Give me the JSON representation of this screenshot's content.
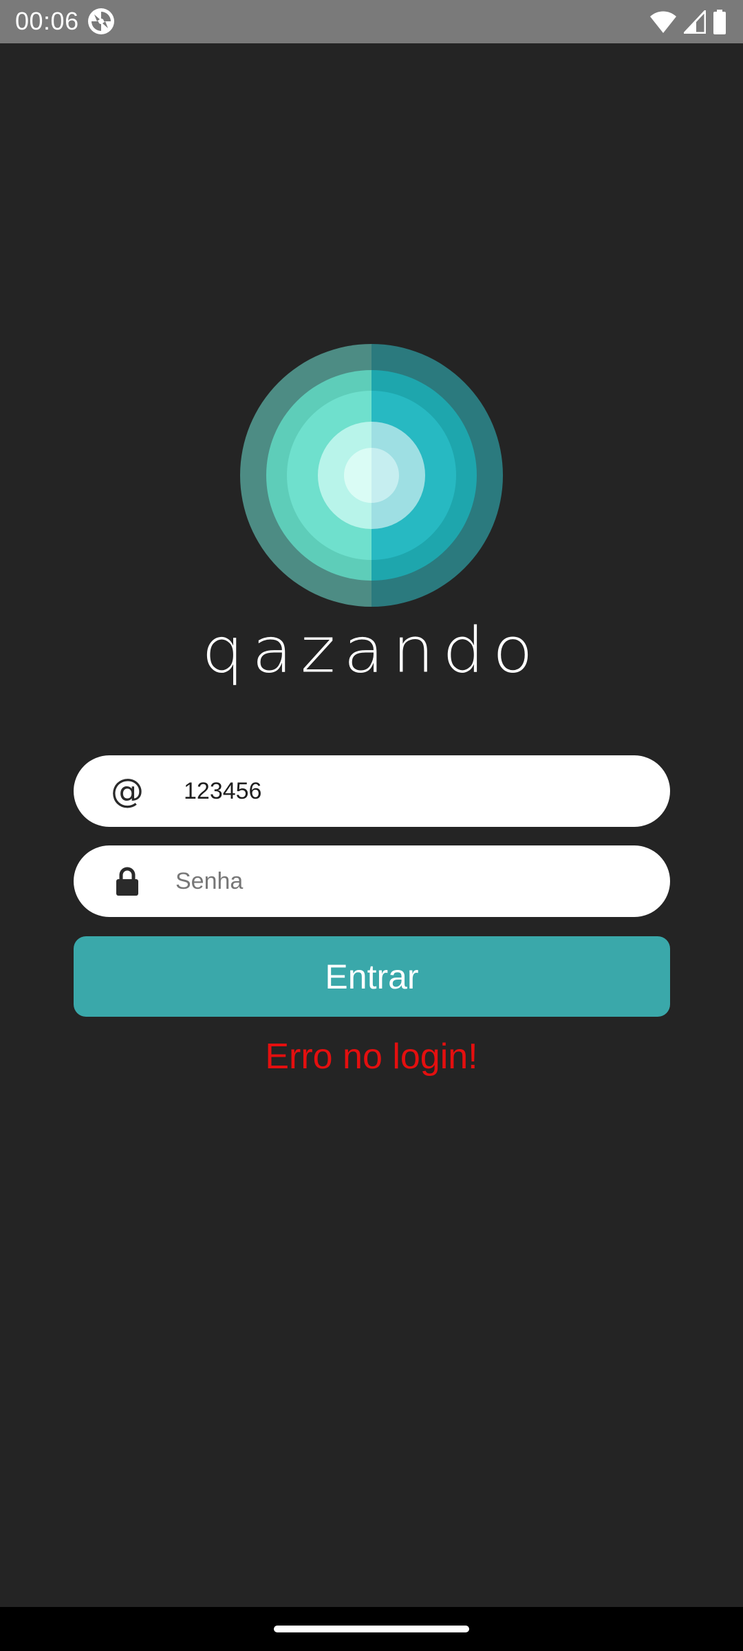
{
  "status_bar": {
    "time": "00:06",
    "icons": [
      "app-notification-icon",
      "wifi-icon",
      "cellular-signal-icon",
      "battery-icon"
    ]
  },
  "logo": {
    "wordmark": "qazando",
    "colors": [
      "#4d8c84",
      "#2b7a7e",
      "#5ecdb9",
      "#27b9c2",
      "#b8f4ea",
      "#9edfe3"
    ]
  },
  "login_form": {
    "email": {
      "icon": "at-icon",
      "value": "123456",
      "placeholder": ""
    },
    "password": {
      "icon": "lock-icon",
      "value": "",
      "placeholder": "Senha"
    },
    "submit_label": "Entrar",
    "error_message": "Erro no login!"
  },
  "colors": {
    "background": "#242424",
    "accent": "#3aa8aa",
    "error": "#e40f0f",
    "status_bar": "#7a7a7a"
  }
}
